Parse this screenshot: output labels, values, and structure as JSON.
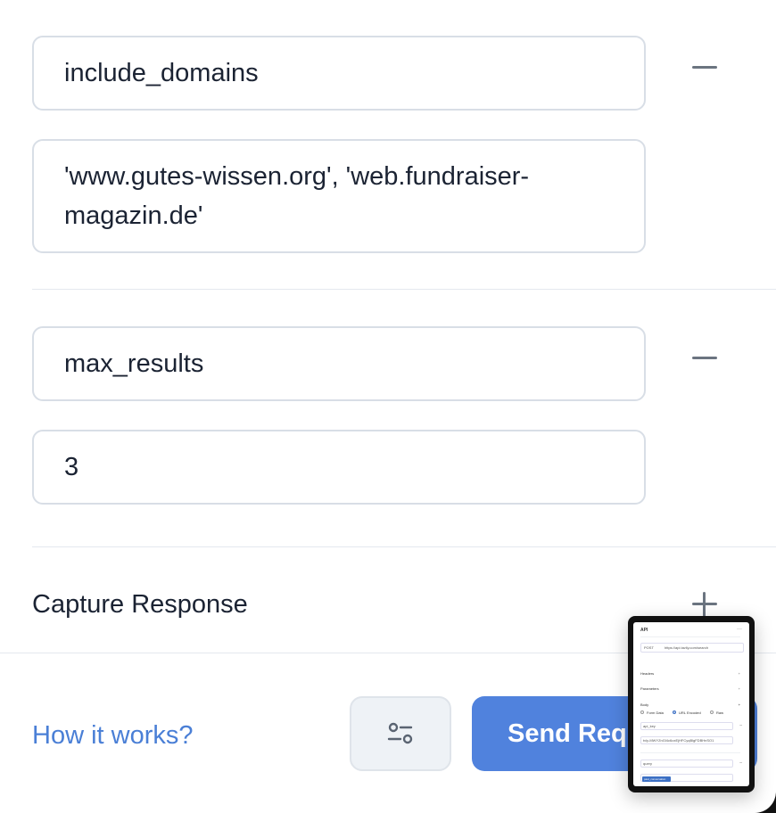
{
  "params": [
    {
      "key": "include_domains",
      "value": "'www.gutes-wissen.org', 'web.fundraiser-magazin.de'"
    },
    {
      "key": "max_results",
      "value": "3"
    }
  ],
  "capture": {
    "label": "Capture Response"
  },
  "footer": {
    "help_link": "How it works?",
    "send_label": "Send Request"
  },
  "thumbnail": {
    "title": "API",
    "menu": "···",
    "method": "POST",
    "url": "https://api.tavily.com/search",
    "headers": "Headers",
    "parameters": "Parameters",
    "body": "Body",
    "opt_form": "Form Data",
    "opt_url": "URL Encoded",
    "opt_raw": "Raw",
    "field1": "api_key",
    "field2": "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",
    "field3": "query",
    "chip": "past_conversation"
  },
  "colors": {
    "accent": "#5082dd",
    "link": "#4a7fd6",
    "border": "#d8dee6"
  }
}
